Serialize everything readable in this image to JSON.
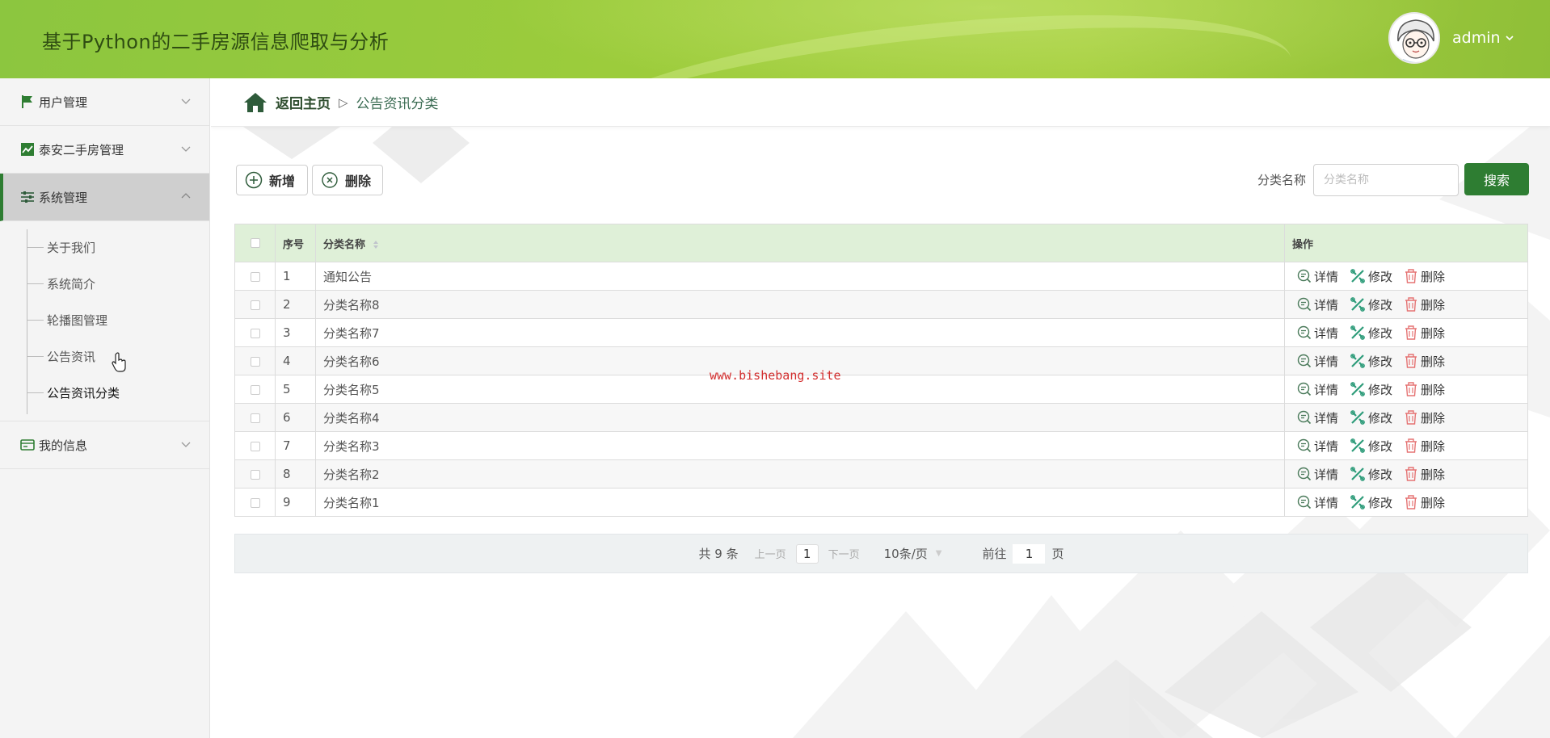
{
  "app": {
    "title": "基于Python的二手房源信息爬取与分析",
    "username": "admin"
  },
  "sidebar": {
    "menus": [
      {
        "label": "用户管理",
        "icon": "flag-icon"
      },
      {
        "label": "泰安二手房管理",
        "icon": "trend-chart-icon"
      },
      {
        "label": "系统管理",
        "icon": "sliders-icon",
        "expanded": true
      },
      {
        "label": "我的信息",
        "icon": "id-card-icon"
      }
    ],
    "system_submenu": [
      "关于我们",
      "系统简介",
      "轮播图管理",
      "公告资讯",
      "公告资讯分类"
    ]
  },
  "breadcrumb": {
    "home": "返回主页",
    "separator": "▷",
    "current": "公告资讯分类"
  },
  "toolbar": {
    "add_label": "新增",
    "delete_label": "删除",
    "search_label": "分类名称",
    "search_placeholder": "分类名称",
    "search_button": "搜索"
  },
  "table": {
    "headers": {
      "index": "序号",
      "name": "分类名称",
      "ops": "操作"
    },
    "rows": [
      {
        "index": "1",
        "name": "通知公告"
      },
      {
        "index": "2",
        "name": "分类名称8"
      },
      {
        "index": "3",
        "name": "分类名称7"
      },
      {
        "index": "4",
        "name": "分类名称6"
      },
      {
        "index": "5",
        "name": "分类名称5"
      },
      {
        "index": "6",
        "name": "分类名称4"
      },
      {
        "index": "7",
        "name": "分类名称3"
      },
      {
        "index": "8",
        "name": "分类名称2"
      },
      {
        "index": "9",
        "name": "分类名称1"
      }
    ],
    "actions": {
      "detail": "详情",
      "edit": "修改",
      "delete": "删除"
    }
  },
  "pagination": {
    "total": "共 9 条",
    "prev": "上一页",
    "page": "1",
    "next": "下一页",
    "page_size": "10条/页",
    "goto_label": "前往",
    "goto_value": "1",
    "goto_suffix": "页"
  },
  "watermark": "www.bishebang.site",
  "colors": {
    "header_green": "#9ccc3c",
    "primary_green": "#2e7d32",
    "table_header_bg": "#dff0d8",
    "detail_icon": "#4a7a5a",
    "edit_icon": "#2e9c7a",
    "delete_icon": "#e57373",
    "watermark": "#d32f2f"
  }
}
